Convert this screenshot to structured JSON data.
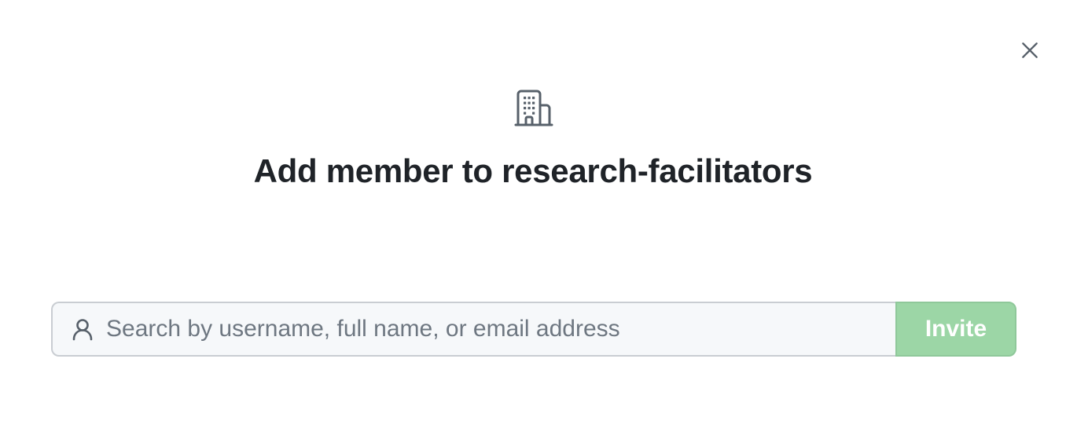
{
  "dialog": {
    "title": "Add member to research-facilitators",
    "close_icon": "close-icon",
    "header_icon": "organization-icon"
  },
  "invite": {
    "search_placeholder": "Search by username, full name, or email address",
    "search_value": "",
    "search_icon": "person-icon",
    "button_label": "Invite",
    "button_disabled": true
  },
  "colors": {
    "title_text": "#1f2328",
    "icon_gray": "#57606a",
    "input_bg": "#f6f8fa",
    "input_border": "#c9cdd2",
    "placeholder": "#6e7781",
    "invite_bg_disabled": "#9cd6a6",
    "invite_text": "#ffffff"
  }
}
